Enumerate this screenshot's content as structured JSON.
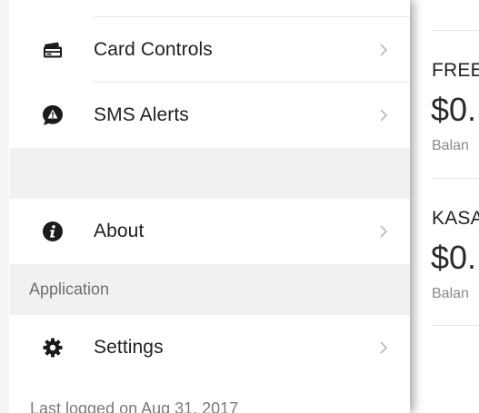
{
  "drawer": {
    "items": [
      {
        "id": "card-controls",
        "label": "Card Controls",
        "icon": "credit-card-icon"
      },
      {
        "id": "sms-alerts",
        "label": "SMS Alerts",
        "icon": "alert-bubble-icon"
      },
      {
        "id": "about",
        "label": "About",
        "icon": "info-icon"
      },
      {
        "id": "settings",
        "label": "Settings",
        "icon": "gear-icon"
      }
    ],
    "section_application": "Application",
    "footer": "Last logged on Aug 31, 2017"
  },
  "accounts": [
    {
      "name": "FREE",
      "balance": "$0.",
      "label": "Balan"
    },
    {
      "name": "KASA",
      "balance": "$0.",
      "label": "Balan"
    }
  ],
  "colors": {
    "section_bg": "#f1f1f1",
    "divider": "#e8e8e8",
    "text_primary": "#1f1f1f",
    "text_secondary": "#6e6e6e"
  }
}
